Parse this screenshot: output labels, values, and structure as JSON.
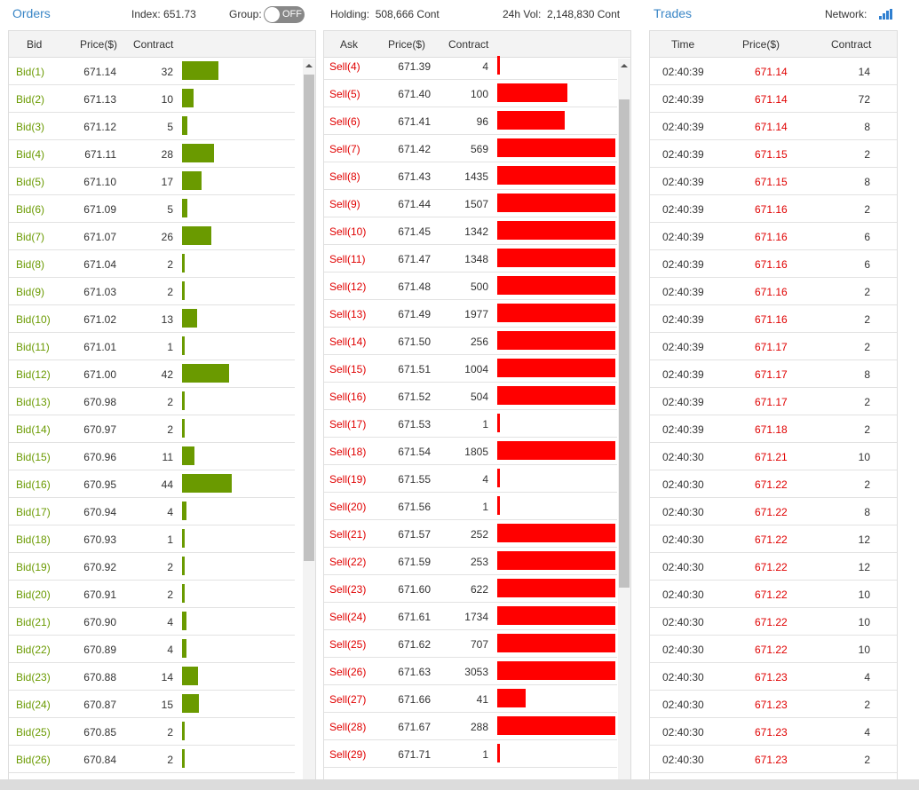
{
  "header": {
    "orders_title": "Orders",
    "index_label": "Index:",
    "index_value": "651.73",
    "group_label": "Group:",
    "group_toggle": "OFF",
    "holding_label": "Holding:",
    "holding_value": "508,666 Cont",
    "vol_label": "24h Vol:",
    "vol_value": "2,148,830 Cont",
    "trades_title": "Trades",
    "network_label": "Network:",
    "network_icon": "signal-bars-icon"
  },
  "colors": {
    "bid": "#6a9a00",
    "sell": "#ff0000",
    "link": "#3a86c6"
  },
  "bids": {
    "columns": [
      "Bid",
      "Price($)",
      "Contract"
    ],
    "max_contract": 44,
    "rows": [
      {
        "label": "Bid(1)",
        "price": "671.14",
        "contract": 32
      },
      {
        "label": "Bid(2)",
        "price": "671.13",
        "contract": 10
      },
      {
        "label": "Bid(3)",
        "price": "671.12",
        "contract": 5
      },
      {
        "label": "Bid(4)",
        "price": "671.11",
        "contract": 28
      },
      {
        "label": "Bid(5)",
        "price": "671.10",
        "contract": 17
      },
      {
        "label": "Bid(6)",
        "price": "671.09",
        "contract": 5
      },
      {
        "label": "Bid(7)",
        "price": "671.07",
        "contract": 26
      },
      {
        "label": "Bid(8)",
        "price": "671.04",
        "contract": 2
      },
      {
        "label": "Bid(9)",
        "price": "671.03",
        "contract": 2
      },
      {
        "label": "Bid(10)",
        "price": "671.02",
        "contract": 13
      },
      {
        "label": "Bid(11)",
        "price": "671.01",
        "contract": 1
      },
      {
        "label": "Bid(12)",
        "price": "671.00",
        "contract": 42
      },
      {
        "label": "Bid(13)",
        "price": "670.98",
        "contract": 2
      },
      {
        "label": "Bid(14)",
        "price": "670.97",
        "contract": 2
      },
      {
        "label": "Bid(15)",
        "price": "670.96",
        "contract": 11
      },
      {
        "label": "Bid(16)",
        "price": "670.95",
        "contract": 44
      },
      {
        "label": "Bid(17)",
        "price": "670.94",
        "contract": 4
      },
      {
        "label": "Bid(18)",
        "price": "670.93",
        "contract": 1
      },
      {
        "label": "Bid(19)",
        "price": "670.92",
        "contract": 2
      },
      {
        "label": "Bid(20)",
        "price": "670.91",
        "contract": 2
      },
      {
        "label": "Bid(21)",
        "price": "670.90",
        "contract": 4
      },
      {
        "label": "Bid(22)",
        "price": "670.89",
        "contract": 4
      },
      {
        "label": "Bid(23)",
        "price": "670.88",
        "contract": 14
      },
      {
        "label": "Bid(24)",
        "price": "670.87",
        "contract": 15
      },
      {
        "label": "Bid(25)",
        "price": "670.85",
        "contract": 2
      },
      {
        "label": "Bid(26)",
        "price": "670.84",
        "contract": 2
      }
    ]
  },
  "asks": {
    "columns": [
      "Ask",
      "Price($)",
      "Contract"
    ],
    "max_contract": 169,
    "rows": [
      {
        "label": "Sell(4)",
        "price": "671.39",
        "contract": 4
      },
      {
        "label": "Sell(5)",
        "price": "671.40",
        "contract": 100
      },
      {
        "label": "Sell(6)",
        "price": "671.41",
        "contract": 96
      },
      {
        "label": "Sell(7)",
        "price": "671.42",
        "contract": 569
      },
      {
        "label": "Sell(8)",
        "price": "671.43",
        "contract": 1435
      },
      {
        "label": "Sell(9)",
        "price": "671.44",
        "contract": 1507
      },
      {
        "label": "Sell(10)",
        "price": "671.45",
        "contract": 1342
      },
      {
        "label": "Sell(11)",
        "price": "671.47",
        "contract": 1348
      },
      {
        "label": "Sell(12)",
        "price": "671.48",
        "contract": 500
      },
      {
        "label": "Sell(13)",
        "price": "671.49",
        "contract": 1977
      },
      {
        "label": "Sell(14)",
        "price": "671.50",
        "contract": 256
      },
      {
        "label": "Sell(15)",
        "price": "671.51",
        "contract": 1004
      },
      {
        "label": "Sell(16)",
        "price": "671.52",
        "contract": 504
      },
      {
        "label": "Sell(17)",
        "price": "671.53",
        "contract": 1
      },
      {
        "label": "Sell(18)",
        "price": "671.54",
        "contract": 1805
      },
      {
        "label": "Sell(19)",
        "price": "671.55",
        "contract": 4
      },
      {
        "label": "Sell(20)",
        "price": "671.56",
        "contract": 1
      },
      {
        "label": "Sell(21)",
        "price": "671.57",
        "contract": 252
      },
      {
        "label": "Sell(22)",
        "price": "671.59",
        "contract": 253
      },
      {
        "label": "Sell(23)",
        "price": "671.60",
        "contract": 622
      },
      {
        "label": "Sell(24)",
        "price": "671.61",
        "contract": 1734
      },
      {
        "label": "Sell(25)",
        "price": "671.62",
        "contract": 707
      },
      {
        "label": "Sell(26)",
        "price": "671.63",
        "contract": 3053
      },
      {
        "label": "Sell(27)",
        "price": "671.66",
        "contract": 41
      },
      {
        "label": "Sell(28)",
        "price": "671.67",
        "contract": 288
      },
      {
        "label": "Sell(29)",
        "price": "671.71",
        "contract": 1
      }
    ]
  },
  "trades": {
    "columns": [
      "Time",
      "Price($)",
      "Contract"
    ],
    "rows": [
      {
        "time": "02:40:39",
        "price": "671.14",
        "contract": "14"
      },
      {
        "time": "02:40:39",
        "price": "671.14",
        "contract": "72"
      },
      {
        "time": "02:40:39",
        "price": "671.14",
        "contract": "8"
      },
      {
        "time": "02:40:39",
        "price": "671.15",
        "contract": "2"
      },
      {
        "time": "02:40:39",
        "price": "671.15",
        "contract": "8"
      },
      {
        "time": "02:40:39",
        "price": "671.16",
        "contract": "2"
      },
      {
        "time": "02:40:39",
        "price": "671.16",
        "contract": "6"
      },
      {
        "time": "02:40:39",
        "price": "671.16",
        "contract": "6"
      },
      {
        "time": "02:40:39",
        "price": "671.16",
        "contract": "2"
      },
      {
        "time": "02:40:39",
        "price": "671.16",
        "contract": "2"
      },
      {
        "time": "02:40:39",
        "price": "671.17",
        "contract": "2"
      },
      {
        "time": "02:40:39",
        "price": "671.17",
        "contract": "8"
      },
      {
        "time": "02:40:39",
        "price": "671.17",
        "contract": "2"
      },
      {
        "time": "02:40:39",
        "price": "671.18",
        "contract": "2"
      },
      {
        "time": "02:40:30",
        "price": "671.21",
        "contract": "10"
      },
      {
        "time": "02:40:30",
        "price": "671.22",
        "contract": "2"
      },
      {
        "time": "02:40:30",
        "price": "671.22",
        "contract": "8"
      },
      {
        "time": "02:40:30",
        "price": "671.22",
        "contract": "12"
      },
      {
        "time": "02:40:30",
        "price": "671.22",
        "contract": "12"
      },
      {
        "time": "02:40:30",
        "price": "671.22",
        "contract": "10"
      },
      {
        "time": "02:40:30",
        "price": "671.22",
        "contract": "10"
      },
      {
        "time": "02:40:30",
        "price": "671.22",
        "contract": "10"
      },
      {
        "time": "02:40:30",
        "price": "671.23",
        "contract": "4"
      },
      {
        "time": "02:40:30",
        "price": "671.23",
        "contract": "2"
      },
      {
        "time": "02:40:30",
        "price": "671.23",
        "contract": "4"
      },
      {
        "time": "02:40:30",
        "price": "671.23",
        "contract": "2"
      }
    ]
  }
}
